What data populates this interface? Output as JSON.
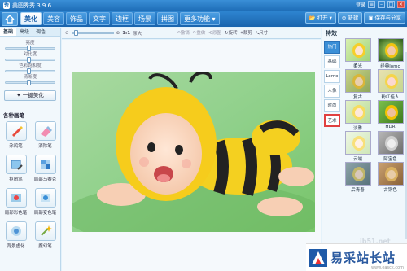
{
  "window": {
    "title": "美图秀秀 3.9.6",
    "login": "登录"
  },
  "menu": {
    "tabs": [
      "美化",
      "美容",
      "饰品",
      "文字",
      "边框",
      "场景",
      "拼图",
      "更多功能"
    ],
    "active": "美化"
  },
  "topright": {
    "open": "打开",
    "new": "新建",
    "save": "保存与分享"
  },
  "left": {
    "tabs": [
      "基础",
      "高级",
      "调色"
    ],
    "sliders": [
      {
        "label": "亮度",
        "value": 0.5
      },
      {
        "label": "对比度",
        "value": 0.5
      },
      {
        "label": "色彩饱和度",
        "value": 0.5
      },
      {
        "label": "清晰度",
        "value": 0.5
      }
    ],
    "onekey": "一键美化",
    "brush_title": "各种画笔",
    "brushes": [
      "涂鸦笔",
      "消除笔",
      "抠图笔",
      "局部马赛克",
      "局部彩色笔",
      "局部变色笔",
      "背景虚化",
      "魔幻笔"
    ]
  },
  "toolbar": {
    "zoom_value": "1:1",
    "original": "原大",
    "undo": "撤销",
    "redo": "重做",
    "reset": "原图",
    "rotate": "旋转",
    "crop": "裁剪",
    "size": "尺寸"
  },
  "right": {
    "title": "特效",
    "categories": [
      "热门",
      "基础",
      "Lomo",
      "人像",
      "时尚",
      "艺术"
    ],
    "active_category": "热门",
    "selected_category": "艺术",
    "thumbs": [
      "柔光",
      "经典lomo",
      "复古",
      "粉红佳人",
      "淡雅",
      "HDR",
      "云端",
      "阿宝色",
      "后青春",
      "古铜色"
    ]
  },
  "watermark": {
    "text": "易采站长站",
    "site": "www.easck.com",
    "url": "ib51.net"
  }
}
